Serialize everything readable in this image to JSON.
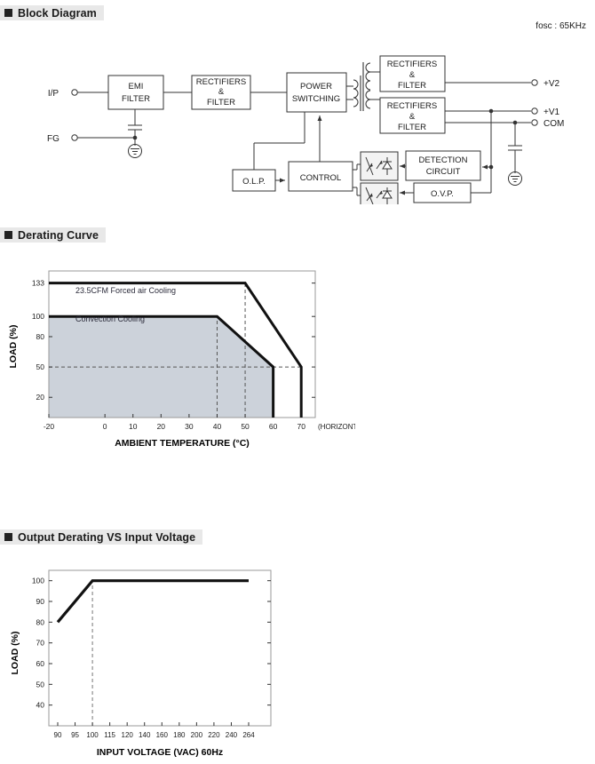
{
  "sections": {
    "block_diagram": {
      "title": "Block Diagram",
      "note": "fosc : 65KHz"
    },
    "derating_curve": {
      "title": "Derating Curve"
    },
    "output_derating": {
      "title": "Output Derating VS Input Voltage"
    }
  },
  "block_diagram": {
    "inputs": [
      {
        "label": "I/P"
      },
      {
        "label": "FG"
      }
    ],
    "outputs": [
      {
        "label": "+V2"
      },
      {
        "label": "+V1"
      },
      {
        "label": "COM"
      }
    ],
    "blocks": [
      {
        "id": "emi",
        "lines": [
          "EMI",
          "FILTER"
        ]
      },
      {
        "id": "rect1",
        "lines": [
          "RECTIFIERS",
          "&",
          "FILTER"
        ]
      },
      {
        "id": "power",
        "lines": [
          "POWER",
          "SWITCHING"
        ]
      },
      {
        "id": "rect_out2",
        "lines": [
          "RECTIFIERS",
          "&",
          "FILTER"
        ]
      },
      {
        "id": "rect_out1",
        "lines": [
          "RECTIFIERS",
          "&",
          "FILTER"
        ]
      },
      {
        "id": "olp",
        "lines": [
          "O.L.P."
        ]
      },
      {
        "id": "control",
        "lines": [
          "CONTROL"
        ]
      },
      {
        "id": "detection",
        "lines": [
          "DETECTION",
          "CIRCUIT"
        ]
      },
      {
        "id": "ovp",
        "lines": [
          "O.V.P."
        ]
      }
    ]
  },
  "chart_data": [
    {
      "type": "line",
      "id": "derating-curve",
      "title": "Derating Curve",
      "xlabel": "AMBIENT TEMPERATURE (°C)",
      "ylabel": "LOAD (%)",
      "xlim": [
        -20,
        75
      ],
      "ylim": [
        0,
        145
      ],
      "xticks": [
        -20,
        0,
        10,
        20,
        30,
        40,
        50,
        60,
        70
      ],
      "xticklabels": [
        "-20",
        "0",
        "10",
        "20",
        "30",
        "40",
        "50",
        "60",
        "70"
      ],
      "yticks": [
        20,
        50,
        80,
        100,
        133
      ],
      "yticklabels": [
        "20",
        "50",
        "80",
        "100",
        "133"
      ],
      "axis_note": "(HORIZONTAL)",
      "grid": false,
      "guides": [
        {
          "type": "vertical",
          "x": 40,
          "style": "dashed"
        },
        {
          "type": "vertical",
          "x": 50,
          "style": "dashed"
        },
        {
          "type": "horizontal",
          "y": 50,
          "style": "dashed"
        }
      ],
      "series": [
        {
          "name": "23.5CFM Forced air Cooling",
          "annotation": "23.5CFM Forced air Cooling",
          "x": [
            -20,
            50,
            70,
            70
          ],
          "y": [
            133,
            133,
            50,
            0
          ],
          "filled": false
        },
        {
          "name": "Convection Cooling",
          "annotation": "Convection Cooling",
          "x": [
            -20,
            40,
            60,
            60
          ],
          "y": [
            100,
            100,
            50,
            0
          ],
          "filled": true,
          "fill_color": "#ccd2da"
        }
      ]
    },
    {
      "type": "line",
      "id": "output-derating-vs-input-voltage",
      "title": "Output Derating VS Input Voltage",
      "xlabel": "INPUT VOLTAGE (VAC) 60Hz",
      "ylabel": "LOAD (%)",
      "ylim": [
        30,
        105
      ],
      "yticks": [
        40,
        50,
        60,
        70,
        80,
        90,
        100
      ],
      "yticklabels": [
        "40",
        "50",
        "60",
        "70",
        "80",
        "90",
        "100"
      ],
      "xticklabels": [
        "90",
        "95",
        "100",
        "115",
        "120",
        "140",
        "160",
        "180",
        "200",
        "220",
        "240",
        "264"
      ],
      "grid": false,
      "guides": [
        {
          "type": "vertical",
          "x": "100",
          "style": "dashed"
        }
      ],
      "series": [
        {
          "name": "load",
          "points": [
            {
              "x": "90",
              "y": 80
            },
            {
              "x": "100",
              "y": 100
            },
            {
              "x": "264",
              "y": 100
            }
          ]
        }
      ]
    }
  ]
}
